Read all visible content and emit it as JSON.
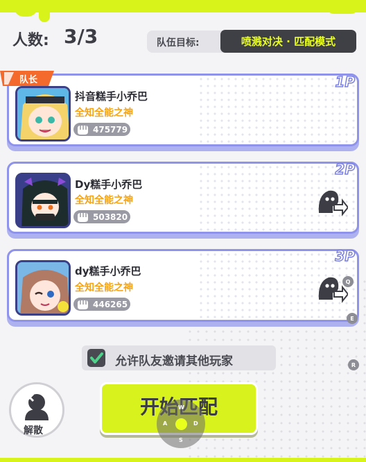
{
  "header": {
    "count_label": "人数:",
    "count_value": "3/3",
    "goal_label": "队伍目标:",
    "goal_mode": "喷溅对决 · 匹配模式"
  },
  "leader_badge": "队长",
  "players": [
    {
      "slot": "1P",
      "name": "抖音糕手小乔巴",
      "title": "全知全能之神",
      "score": "475779",
      "avatar_icon": "blonde-girl-avatar"
    },
    {
      "slot": "2P",
      "name": "Dy糕手小乔巴",
      "title": "全知全能之神",
      "score": "503820",
      "avatar_icon": "dark-hair-girl-avatar"
    },
    {
      "slot": "3P",
      "name": "dy糕手小乔巴",
      "title": "全知全能之神",
      "score": "446265",
      "avatar_icon": "brown-hair-girl-avatar"
    }
  ],
  "invite_option": {
    "label": "允许队友邀请其他玩家",
    "checked": true
  },
  "disband_label": "解散",
  "start_label": "开始匹配",
  "key_hints": {
    "q": "Q",
    "e": "E",
    "r": "R",
    "w": "W",
    "a": "A",
    "s": "S",
    "d": "D"
  },
  "colors": {
    "lime": "#d8f31a",
    "purple": "#8f93ea",
    "title_orange": "#f5a417",
    "pill_text": "#e9ff1c"
  }
}
